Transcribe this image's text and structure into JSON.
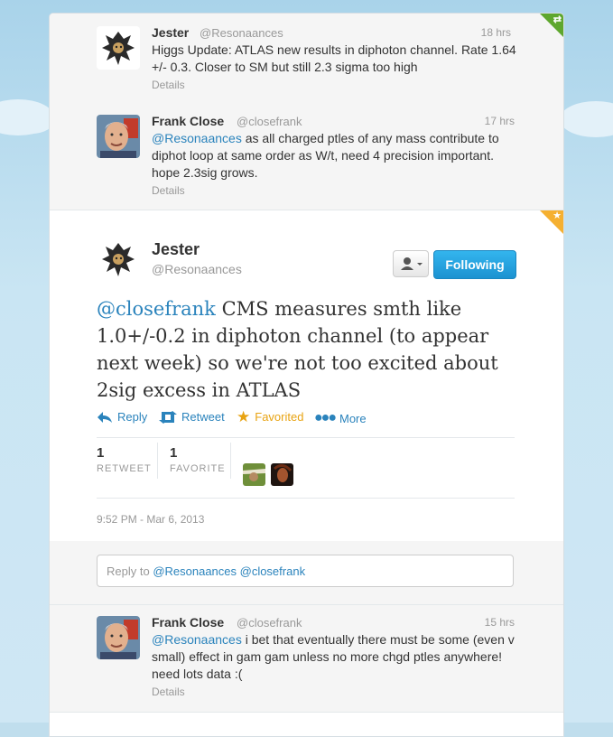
{
  "tweets_above": [
    {
      "name": "Jester",
      "handle": "@Resonaances",
      "time": "18 hrs",
      "text": "Higgs Update: ATLAS new results in diphoton channel. Rate 1.64 +/- 0.3. Closer to SM but still 2.3 sigma too high",
      "details": "Details"
    },
    {
      "name": "Frank Close",
      "handle": "@closefrank",
      "time": "17 hrs",
      "mention": "@Resonaances",
      "text": " as all charged ptles of any mass contribute to diphot loop at same order as W/t, need 4 precision important. hope 2.3sig grows.",
      "details": "Details"
    }
  ],
  "main_tweet": {
    "name": "Jester",
    "handle": "@Resonaances",
    "following_label": "Following",
    "mention": "@closefrank",
    "text": " CMS measures smth like 1.0+/-0.2 in diphoton channel (to appear next week) so we're not too excited about 2sig excess in ATLAS",
    "actions": {
      "reply": "Reply",
      "retweet": "Retweet",
      "favorite": "Favorited",
      "more": "More"
    },
    "stats": {
      "retweets_count": "1",
      "retweets_label": "RETWEET",
      "favorites_count": "1",
      "favorites_label": "FAVORITE"
    },
    "timestamp": "9:52 PM - Mar 6, 2013"
  },
  "reply_box": {
    "prefix": "Reply to ",
    "mentions": "@Resonaances @closefrank"
  },
  "tweets_below": [
    {
      "name": "Frank Close",
      "handle": "@closefrank",
      "time": "15 hrs",
      "mention": "@Resonaances",
      "text": " i bet that eventually there must be some (even v small) effect in gam gam unless no more chgd ptles anywhere! need lots data :(",
      "details": "Details"
    }
  ],
  "colors": {
    "link": "#2a83bc",
    "favorite": "#e8a312",
    "follow_button": "#1c92d1",
    "retweet_corner": "#5ea72e",
    "favorite_corner": "#f5b031"
  }
}
